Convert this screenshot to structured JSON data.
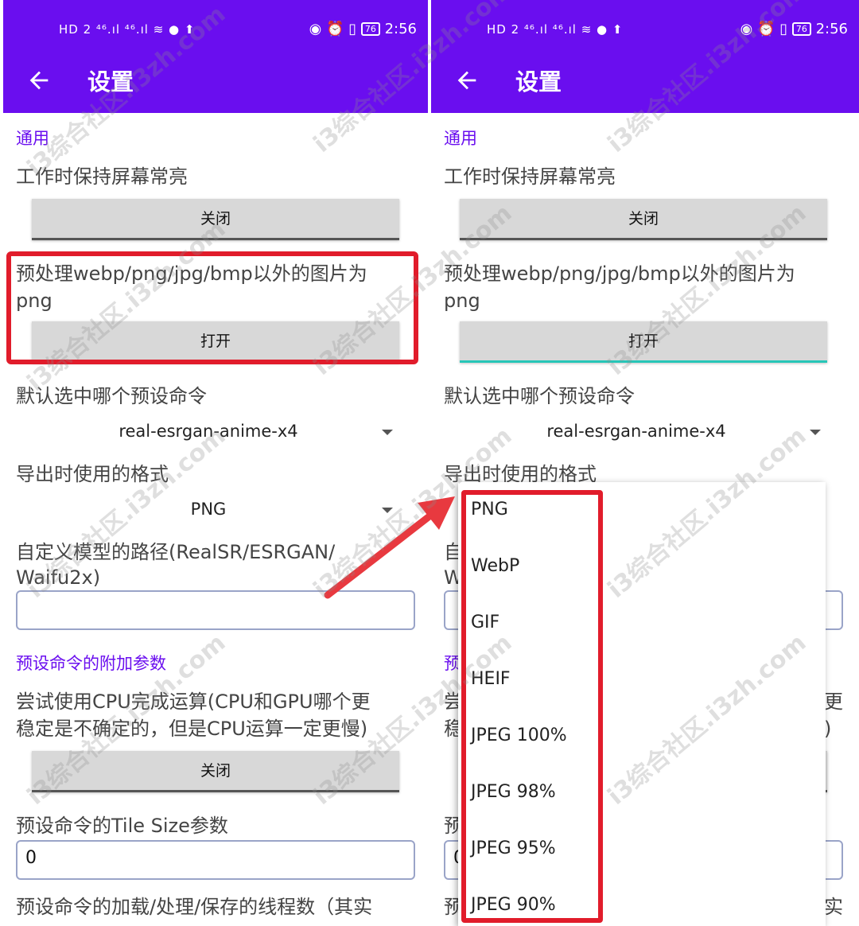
{
  "status_bar": {
    "left_icons": "HD 2 ⁴⁶.ıl ⁴⁶.ıl ≋ ● ⬆",
    "right_icons": "◉ ⏰ ▯",
    "battery": "76",
    "time": "2:56"
  },
  "app_bar": {
    "title": "设置"
  },
  "left": {
    "section_general": "通用",
    "keep_screen_on_label": "工作时保持屏幕常亮",
    "keep_screen_on_button": "关闭",
    "preprocess_label_line1": "预处理webp/png/jpg/bmp以外的图片为",
    "preprocess_label_line2": "png",
    "preprocess_button": "打开",
    "default_preset_label": "默认选中哪个预设命令",
    "default_preset_value": "real-esrgan-anime-x4",
    "export_format_label": "导出时使用的格式",
    "export_format_value": "PNG",
    "model_path_label_line1": "自定义模型的路径(RealSR/ESRGAN/",
    "model_path_label_line2": "Waifu2x)",
    "model_path_value": "",
    "section_preset_params": "预设命令的附加参数",
    "cpu_label_line1": "尝试使用CPU完成运算(CPU和GPU哪个更",
    "cpu_label_line2": "稳定是不确定的，但是CPU运算一定更慢)",
    "cpu_button": "关闭",
    "tile_size_label": "预设命令的Tile Size参数",
    "tile_size_value": "0",
    "threads_label": "预设命令的加载/处理/保存的线程数（其实"
  },
  "right": {
    "section_general": "通用",
    "keep_screen_on_label": "工作时保持屏幕常亮",
    "keep_screen_on_button": "关闭",
    "preprocess_label_line1": "预处理webp/png/jpg/bmp以外的图片为",
    "preprocess_label_line2": "png",
    "preprocess_button": "打开",
    "default_preset_label": "默认选中哪个预设命令",
    "default_preset_value": "real-esrgan-anime-x4",
    "export_format_label": "导出时使用的格式",
    "behind_model_line1": "自",
    "behind_model_line2": "W",
    "behind_section": "预",
    "behind_cpu_line1": "尝",
    "behind_cpu_line2": "稳",
    "behind_tile": "预",
    "behind_tile_value": "0",
    "behind_threads": "预",
    "behind_right_1": "更",
    "behind_right_2": ")",
    "behind_right_3": "实"
  },
  "dropdown": {
    "options": [
      "PNG",
      "WebP",
      "GIF",
      "HEIF",
      "JPEG 100%",
      "JPEG 98%",
      "JPEG 95%",
      "JPEG 90%"
    ]
  },
  "watermark": "i3综合社区.i3zh.com",
  "colors": {
    "primary": "#6a0eef",
    "highlight_red": "#e11c2b",
    "focus_teal": "#26c6b8"
  }
}
